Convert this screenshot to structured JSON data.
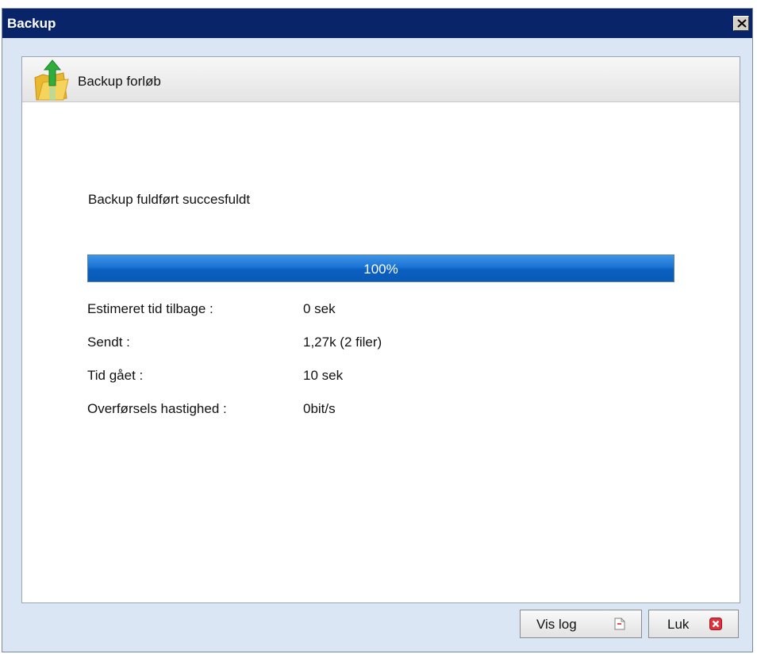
{
  "window": {
    "title": "Backup",
    "close_icon": "close-icon"
  },
  "panel": {
    "title": "Backup forløb",
    "icon": "folder-upload-icon"
  },
  "status": {
    "message": "Backup fuldført succesfuldt"
  },
  "progress": {
    "percent": 100,
    "label": "100%"
  },
  "details": [
    {
      "label": "Estimeret tid tilbage :",
      "value": "0 sek"
    },
    {
      "label": "Sendt :",
      "value": "1,27k (2 filer)"
    },
    {
      "label": "Tid gået :",
      "value": "10 sek"
    },
    {
      "label": "Overførsels hastighed :",
      "value": "0bit/s"
    }
  ],
  "buttons": {
    "view_log": {
      "label": "Vis log",
      "icon": "document-icon"
    },
    "close": {
      "label": "Luk",
      "icon": "red-x-icon"
    }
  },
  "colors": {
    "title_bar": "#0a246a",
    "progress": "#1a73d4",
    "close_icon": "#e0303a"
  }
}
